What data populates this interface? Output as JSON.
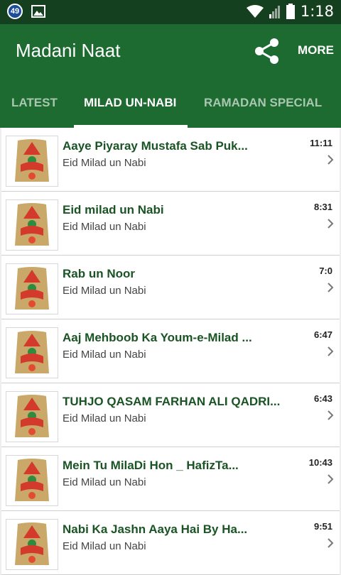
{
  "statusbar": {
    "badge": "49",
    "time": "1:18"
  },
  "appbar": {
    "title": "Madani Naat",
    "more_label": "MORE"
  },
  "tabs": [
    {
      "label": "LATEST",
      "active": false
    },
    {
      "label": "MILAD UN-NABI",
      "active": true
    },
    {
      "label": "RAMADAN SPECIAL",
      "active": false
    }
  ],
  "items": [
    {
      "title": "Aaye Piyaray Mustafa Sab Puk...",
      "subtitle": "Eid Milad un Nabi",
      "duration": "11:11"
    },
    {
      "title": "Eid milad un Nabi",
      "subtitle": "Eid Milad un Nabi",
      "duration": "8:31"
    },
    {
      "title": "Rab un Noor",
      "subtitle": "Eid Milad un Nabi",
      "duration": "7:0"
    },
    {
      "title": "Aaj Mehboob Ka Youm-e-Milad ...",
      "subtitle": "Eid Milad un Nabi",
      "duration": "6:47"
    },
    {
      "title": "TUHJO QASAM FARHAN ALI QADRI...",
      "subtitle": "Eid Milad un Nabi",
      "duration": "6:43"
    },
    {
      "title": "Mein Tu MilaDi Hon _ HafizTa...",
      "subtitle": "Eid Milad un Nabi",
      "duration": "10:43"
    },
    {
      "title": "Nabi Ka Jashn Aaya Hai By Ha...",
      "subtitle": "Eid Milad un Nabi",
      "duration": "9:51"
    }
  ],
  "colors": {
    "appbar": "#1e6b31",
    "statusbar": "#15401f",
    "title_text": "#1a5424"
  }
}
